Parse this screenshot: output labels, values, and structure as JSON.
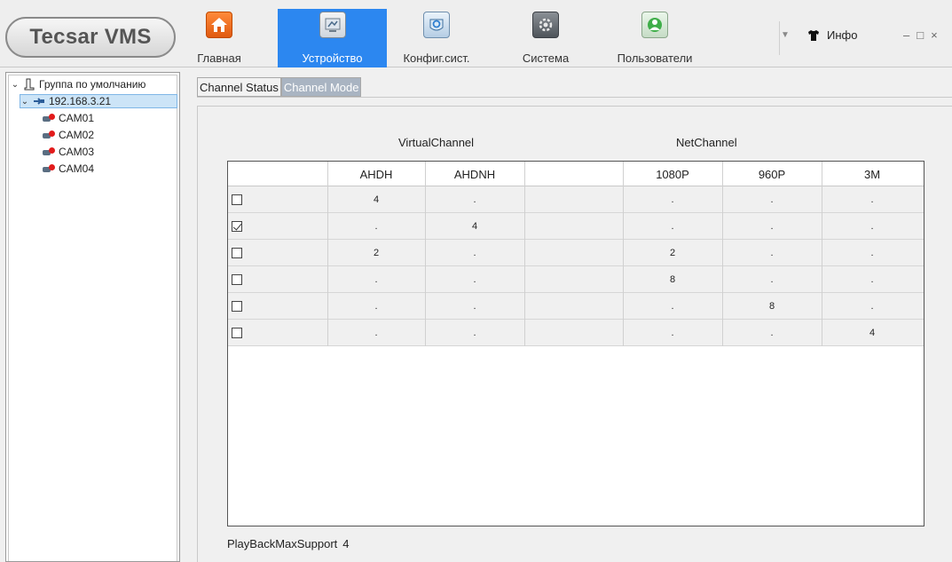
{
  "app": {
    "logo_text": "Tecsar VMS"
  },
  "nav": [
    {
      "label": "Главная",
      "icon": "home-icon"
    },
    {
      "label": "Устройство",
      "icon": "device-icon",
      "active": true
    },
    {
      "label": "Конфиг.сист.",
      "icon": "config-icon"
    },
    {
      "label": "Система",
      "icon": "system-gear-icon"
    },
    {
      "label": "Пользователи",
      "icon": "users-icon"
    }
  ],
  "header": {
    "info_label": "Инфо",
    "min_glyph": "–",
    "max_glyph": "□",
    "close_glyph": "×",
    "dropdown_glyph": "▼"
  },
  "tree": {
    "group_label": "Группа по умолчанию",
    "device_label": "192.168.3.21",
    "cameras": [
      "CAM01",
      "CAM02",
      "CAM03",
      "CAM04"
    ]
  },
  "tabs": [
    {
      "label": "Channel Status",
      "active": false
    },
    {
      "label": "Channel Mode",
      "active": true
    }
  ],
  "groups": {
    "virtual": "VirtualChannel",
    "net": "NetChannel"
  },
  "table": {
    "columns": [
      "",
      "AHDH",
      "AHDNH",
      "",
      "1080P",
      "960P",
      "3M"
    ],
    "rows": [
      {
        "checked": false,
        "cells": [
          "4",
          ".",
          "",
          ".",
          ".",
          "."
        ]
      },
      {
        "checked": true,
        "cells": [
          ".",
          "4",
          "",
          ".",
          ".",
          "."
        ]
      },
      {
        "checked": false,
        "cells": [
          "2",
          ".",
          "",
          "2",
          ".",
          "."
        ]
      },
      {
        "checked": false,
        "cells": [
          ".",
          ".",
          "",
          "8",
          ".",
          "."
        ]
      },
      {
        "checked": false,
        "cells": [
          ".",
          ".",
          "",
          ".",
          "8",
          "."
        ]
      },
      {
        "checked": false,
        "cells": [
          ".",
          ".",
          "",
          ".",
          ".",
          "4"
        ]
      }
    ]
  },
  "playback": {
    "label": "PlayBackMaxSupport",
    "value": "4"
  },
  "colors": {
    "accent": "#2c87f0",
    "tab_active": "#a9b4c2",
    "camera_status": "#e21b1b"
  }
}
